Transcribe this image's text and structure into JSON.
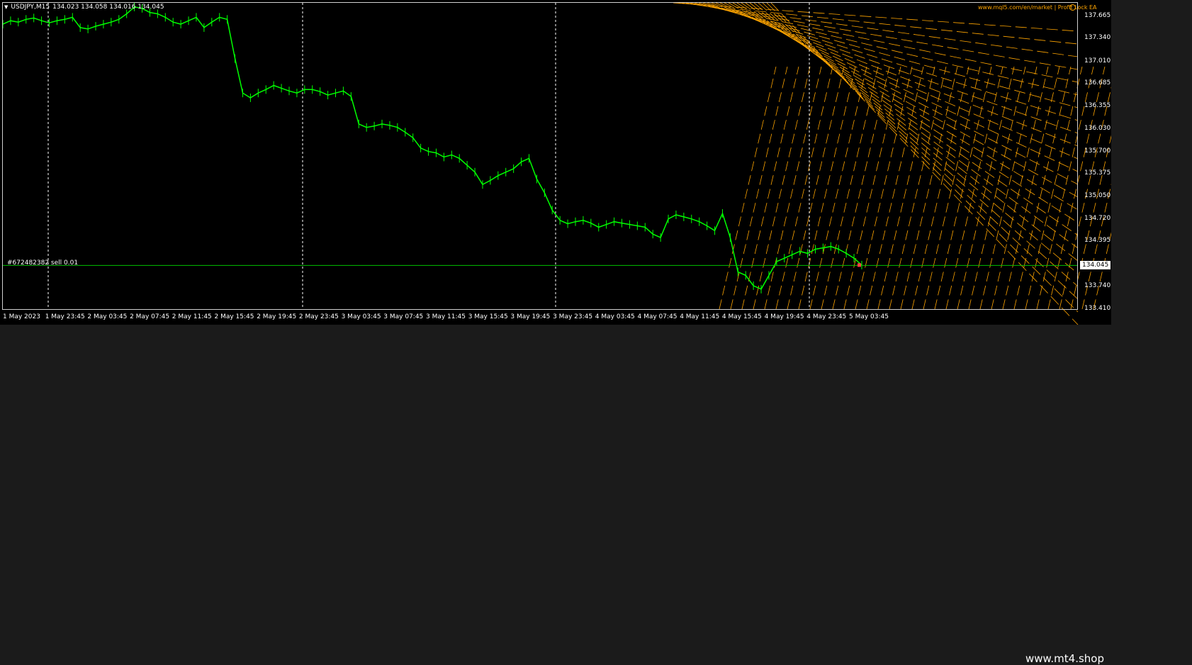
{
  "header": {
    "symbol": "USDJPY,M15",
    "ohlc": "134.023 134.058 134.016 134.045"
  },
  "expert_label": "www.mql5.com/en/market | Profit Lock EA",
  "order_label": "#672482382 sell 0.01",
  "current_price": "134.045",
  "watermark": "www.mt4.shop",
  "colors": {
    "background": "#000000",
    "candle": "#00ff00",
    "grid": "#ffffff",
    "indicator": "#ffa500",
    "order_line": "#00c000"
  },
  "price_axis": [
    "137.665",
    "137.340",
    "137.010",
    "136.685",
    "136.355",
    "136.030",
    "135.700",
    "135.375",
    "135.050",
    "134.720",
    "134.395",
    "134.045",
    "133.740",
    "133.410"
  ],
  "time_axis": [
    "1 May 2023",
    "1 May 23:45",
    "2 May 03:45",
    "2 May 07:45",
    "2 May 11:45",
    "2 May 15:45",
    "2 May 19:45",
    "2 May 23:45",
    "3 May 03:45",
    "3 May 07:45",
    "3 May 11:45",
    "3 May 15:45",
    "3 May 19:45",
    "3 May 23:45",
    "4 May 03:45",
    "4 May 07:45",
    "4 May 11:45",
    "4 May 15:45",
    "4 May 19:45",
    "4 May 23:45",
    "5 May 03:45"
  ],
  "chart_data": {
    "type": "candlestick",
    "symbol": "USDJPY",
    "timeframe": "M15",
    "ylim": [
      133.41,
      137.86
    ],
    "series": [
      {
        "name": "USDJPY",
        "values": [
          137.55,
          137.6,
          137.58,
          137.62,
          137.64,
          137.6,
          137.57,
          137.6,
          137.62,
          137.65,
          137.5,
          137.48,
          137.52,
          137.55,
          137.58,
          137.62,
          137.7,
          137.8,
          137.78,
          137.72,
          137.7,
          137.65,
          137.58,
          137.55,
          137.6,
          137.65,
          137.5,
          137.58,
          137.65,
          137.62,
          137.05,
          136.55,
          136.48,
          136.55,
          136.6,
          136.66,
          136.62,
          136.58,
          136.55,
          136.6,
          136.6,
          136.57,
          136.52,
          136.55,
          136.58,
          136.5,
          136.1,
          136.05,
          136.07,
          136.1,
          136.08,
          136.05,
          135.98,
          135.9,
          135.75,
          135.7,
          135.68,
          135.62,
          135.65,
          135.6,
          135.5,
          135.4,
          135.22,
          135.28,
          135.35,
          135.4,
          135.45,
          135.55,
          135.6,
          135.3,
          135.1,
          134.85,
          134.7,
          134.65,
          134.68,
          134.7,
          134.66,
          134.6,
          134.64,
          134.68,
          134.66,
          134.64,
          134.62,
          134.6,
          134.5,
          134.45,
          134.72,
          134.78,
          134.75,
          134.72,
          134.68,
          134.62,
          134.55,
          134.8,
          134.45,
          133.95,
          133.9,
          133.75,
          133.7,
          133.9,
          134.1,
          134.15,
          134.2,
          134.25,
          134.22,
          134.28,
          134.3,
          134.32,
          134.28,
          134.22,
          134.15,
          134.05
        ]
      }
    ],
    "horizontal_lines": [
      134.045
    ]
  }
}
